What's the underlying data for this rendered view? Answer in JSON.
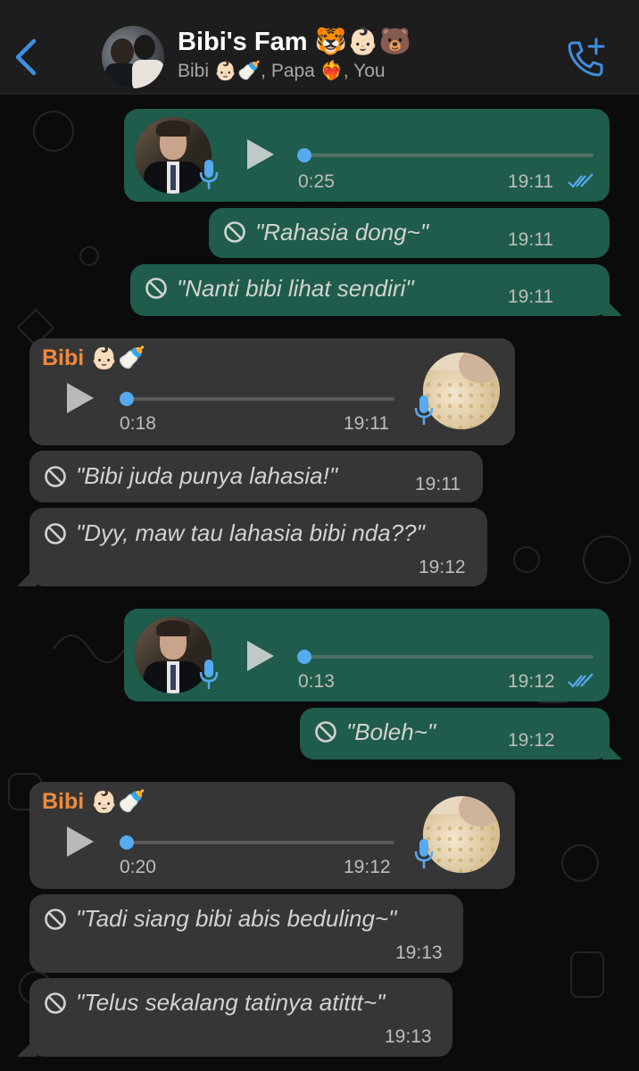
{
  "header": {
    "title": "Bibi's Fam 🐯👶🏻🐻",
    "subtitle": "Bibi 👶🏻🍼, Papa ❤️‍🔥, You"
  },
  "colors": {
    "accent": "#3f8fe0",
    "outgoing": "#1f5c4b",
    "incoming": "#363636",
    "sender": "#f08a3c"
  },
  "messages": [
    {
      "type": "voice",
      "direction": "out",
      "duration": "0:25",
      "time": "19:11",
      "status": "read"
    },
    {
      "type": "deleted",
      "direction": "out",
      "text": "\"Rahasia dong~\"",
      "time": "19:11"
    },
    {
      "type": "deleted",
      "direction": "out",
      "text": "\"Nanti bibi lihat sendiri\"",
      "time": "19:11"
    },
    {
      "type": "voice",
      "direction": "in",
      "sender": "Bibi 👶🏻🍼",
      "duration": "0:18",
      "time": "19:11"
    },
    {
      "type": "deleted",
      "direction": "in",
      "text": "\"Bibi juda punya lahasia!\"",
      "time": "19:11"
    },
    {
      "type": "deleted",
      "direction": "in",
      "text": "\"Dyy, maw tau lahasia bibi nda??\"",
      "time": "19:12"
    },
    {
      "type": "voice",
      "direction": "out",
      "duration": "0:13",
      "time": "19:12",
      "status": "read"
    },
    {
      "type": "deleted",
      "direction": "out",
      "text": "\"Boleh~\"",
      "time": "19:12"
    },
    {
      "type": "voice",
      "direction": "in",
      "sender": "Bibi 👶🏻🍼",
      "duration": "0:20",
      "time": "19:12"
    },
    {
      "type": "deleted",
      "direction": "in",
      "text": "\"Tadi siang bibi abis beduling~\"",
      "time": "19:13"
    },
    {
      "type": "deleted",
      "direction": "in",
      "text": "\"Telus sekalang tatinya atittt~\"",
      "time": "19:13"
    }
  ]
}
